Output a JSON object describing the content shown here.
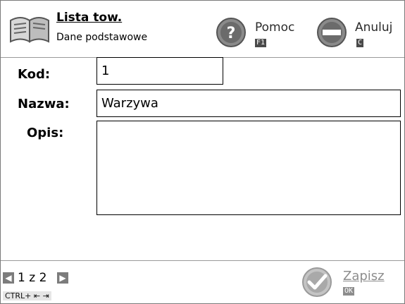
{
  "header": {
    "title": "Lista tow.",
    "subtitle": "Dane podstawowe",
    "icon": "book-icon",
    "help": {
      "label": "Pomoc",
      "shortcut": "F1",
      "icon": "help-icon"
    },
    "cancel": {
      "label": "Anuluj",
      "shortcut": "C",
      "icon": "cancel-icon"
    }
  },
  "form": {
    "code": {
      "label": "Kod:",
      "value": "1"
    },
    "name": {
      "label": "Nazwa:",
      "value": "Warzywa"
    },
    "description": {
      "label": "Opis:",
      "value": ""
    }
  },
  "footer": {
    "pagination": {
      "current": "1",
      "separator": "z",
      "total": "2"
    },
    "shortcut": "CTRL+ ⇤ ⇥",
    "save": {
      "label": "Zapisz",
      "shortcut": "OK",
      "icon": "check-icon"
    }
  },
  "colors": {
    "accent": "#2b2b2b",
    "disabled": "#8d8d8d",
    "keycap": "#4a4a4a"
  }
}
